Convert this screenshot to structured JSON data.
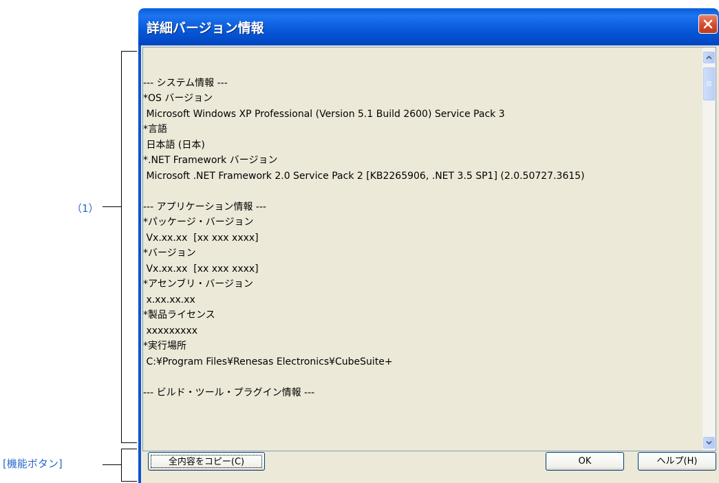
{
  "annotations": {
    "area_label": "（1）",
    "buttons_label": "[機能ボタン]"
  },
  "dialog": {
    "title": "詳細バージョン情報",
    "close_icon": "close-icon",
    "content_lines": [
      "",
      "--- システム情報 ---",
      "*OS バージョン",
      " Microsoft Windows XP Professional (Version 5.1 Build 2600) Service Pack 3",
      "*言語",
      " 日本語 (日本)",
      "*.NET Framework バージョン",
      " Microsoft .NET Framework 2.0 Service Pack 2 [KB2265906, .NET 3.5 SP1] (2.0.50727.3615)",
      "",
      "--- アプリケーション情報 ---",
      "*パッケージ・バージョン",
      " Vx.xx.xx  [xx xxx xxxx]",
      "*バージョン",
      " Vx.xx.xx  [xx xxx xxxx]",
      "*アセンブリ・バージョン",
      " x.xx.xx.xx",
      "*製品ライセンス",
      " xxxxxxxxx",
      "*実行場所",
      " C:¥Program Files¥Renesas Electronics¥CubeSuite+",
      "",
      "--- ビルド・ツール・プラグイン情報 ---"
    ],
    "buttons": {
      "copy_all": "全内容をコピー(C)",
      "ok": "OK",
      "help": "ヘルプ(H)"
    },
    "colors": {
      "title_bar": "#0a5ed8",
      "dialog_face": "#ece9d8",
      "annotation_text": "#2a67c8"
    }
  }
}
